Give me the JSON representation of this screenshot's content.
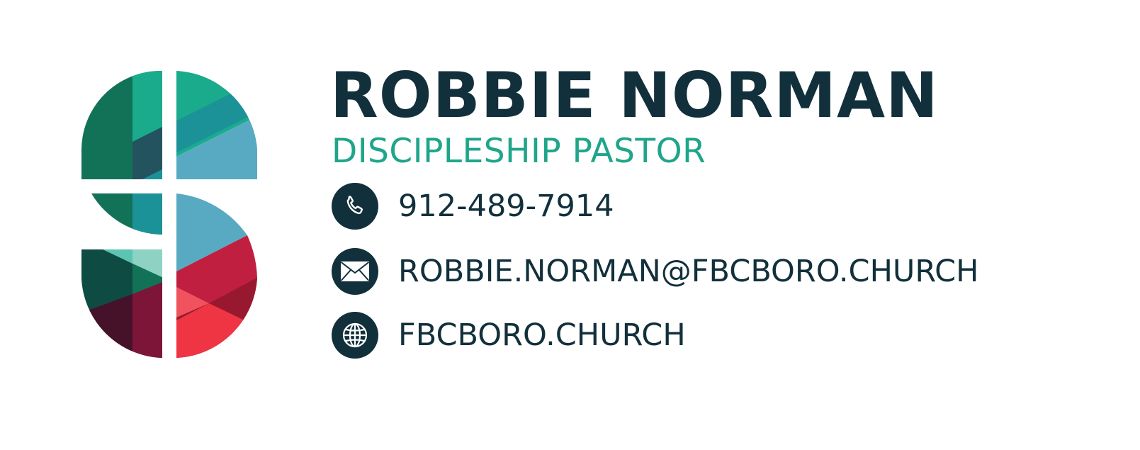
{
  "colors": {
    "navy": "#12303b",
    "teal": "#1fa58a",
    "background": "#ffffff"
  },
  "person": {
    "name": "ROBBIE NORMAN",
    "title": "DISCIPLESHIP PASTOR"
  },
  "contacts": [
    {
      "icon": "phone-icon",
      "text": "912-489-7914"
    },
    {
      "icon": "envelope-icon",
      "text": "ROBBIE.NORMAN@FBCBORO.CHURCH"
    },
    {
      "icon": "globe-icon",
      "text": "FBCBORO.CHURCH"
    }
  ],
  "logo": {
    "icon": "fbc-s-cross-logo",
    "palette": [
      "#127258",
      "#1aab8c",
      "#23535f",
      "#1a9298",
      "#58aac3",
      "#0e4b42",
      "#5dc3b2",
      "#8ed2c4",
      "#c01f40",
      "#98192f",
      "#f0525e",
      "#ef3444",
      "#7d1539",
      "#451229"
    ]
  }
}
